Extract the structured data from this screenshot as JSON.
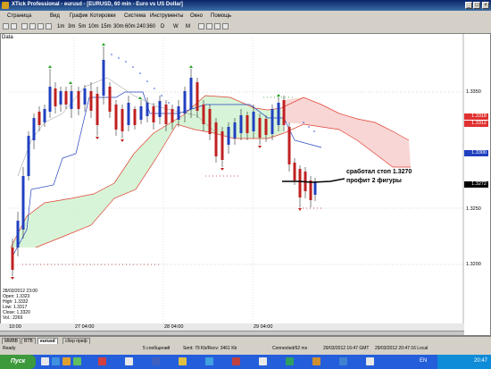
{
  "window": {
    "title": "XTick Professional - eurusd - [EURUSD, 60 min - Euro vs US Dollar]"
  },
  "menu": {
    "items": [
      "Страница",
      "Вид",
      "График",
      "Котировки",
      "Система",
      "Инструменты",
      "Окно",
      "Помощь"
    ]
  },
  "toolbar": {
    "timeframes": [
      "1m",
      "3m",
      "5m",
      "10m",
      "15m",
      "30m",
      "60m",
      "240",
      "360",
      "D",
      "W",
      "M"
    ]
  },
  "chart": {
    "data_label": "Data",
    "price_labels": [
      "1.3350",
      "1.3250",
      "1.3200"
    ],
    "price_tags": {
      "red1": "1.3318",
      "red2": "1.3312",
      "blue": "1.3300",
      "black": "1.3272"
    },
    "date_labels": [
      "10:00",
      "27 04:00",
      "28 04:00",
      "29 04:00"
    ],
    "annotation_line1": "сработал стоп 1.3270",
    "annotation_line2": "профит 2 фигуры",
    "info": {
      "date": "28/03/2012 23:00",
      "open": "Open: 1.3323",
      "high": "High: 1.3332",
      "low": "Low: 1.3317",
      "close": "Close: 1.3320",
      "vol": "Vol.: 2269"
    }
  },
  "tabs": [
    "MMBB",
    "BTB",
    "eurusd",
    "сбер преф"
  ],
  "status": {
    "ready": "Ready",
    "messages": "5 сообщений",
    "sent": "Sent: 79 Kb/Recv: 3461 Kb",
    "connected": "Connected/62 ms",
    "time1": "29/03/2012 16:47 GMT",
    "time2": "29/03/2012 20:47:16 Local"
  },
  "taskbar": {
    "start": "Пуск",
    "lang": "EN",
    "clock": "20:47"
  }
}
